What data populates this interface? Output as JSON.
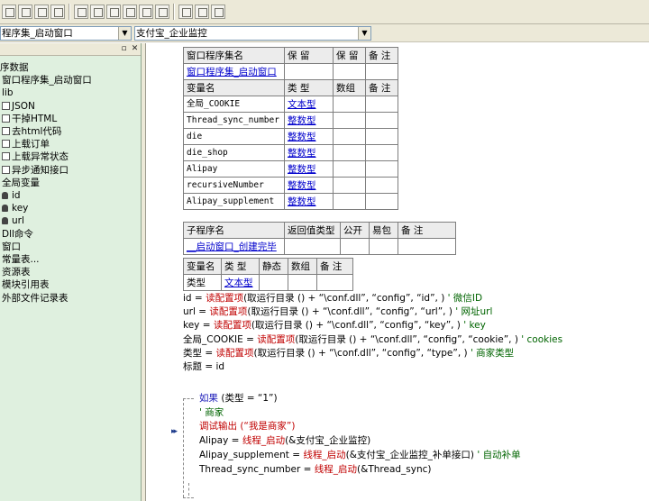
{
  "toolbar": {
    "icons": [
      "indent-icon",
      "outdent-icon",
      "compile-icon",
      "align-left-icon",
      "align-right-icon",
      "align-center-icon",
      "align-top-icon",
      "align-bottom-icon",
      "same-width-icon",
      "same-height-icon",
      "grid-icon"
    ]
  },
  "combos": {
    "left_value": "程序集_启动窗口",
    "right_value": "支付宝_企业监控"
  },
  "tree": {
    "items": [
      {
        "label": "序数据",
        "icon": "none"
      },
      {
        "label": "窗口程序集_启动窗口",
        "icon": "none"
      },
      {
        "label": "lib",
        "icon": "none"
      },
      {
        "label": "JSON",
        "icon": "class-module-icon"
      },
      {
        "label": "干掉HTML",
        "icon": "class-module-icon"
      },
      {
        "label": "去html代码",
        "icon": "class-module-icon"
      },
      {
        "label": "上载订单",
        "icon": "class-module-icon"
      },
      {
        "label": "上载异常状态",
        "icon": "class-module-icon"
      },
      {
        "label": "异步通知接口",
        "icon": "class-module-icon"
      },
      {
        "label": "全局变量",
        "icon": "none"
      },
      {
        "label": "id",
        "icon": "variable-icon"
      },
      {
        "label": "key",
        "icon": "variable-icon"
      },
      {
        "label": "url",
        "icon": "variable-icon"
      },
      {
        "label": "Dll命令",
        "icon": "none"
      },
      {
        "label": "窗口",
        "icon": "none"
      },
      {
        "label": "常量表...",
        "icon": "none"
      },
      {
        "label": "资源表",
        "icon": "none"
      },
      {
        "label": "模块引用表",
        "icon": "none"
      },
      {
        "label": "外部文件记录表",
        "icon": "none"
      }
    ]
  },
  "assembly_table": {
    "headers": [
      "窗口程序集名",
      "保 留",
      "保 留",
      "备 注"
    ],
    "name": "窗口程序集_启动窗口",
    "var_headers": [
      "变量名",
      "类 型",
      "数组",
      "备 注"
    ],
    "vars": [
      {
        "name": "全局_COOKIE",
        "type": "文本型"
      },
      {
        "name": "Thread_sync_number",
        "type": "整数型"
      },
      {
        "name": "die",
        "type": "整数型"
      },
      {
        "name": "die_shop",
        "type": "整数型"
      },
      {
        "name": "Alipay",
        "type": "整数型"
      },
      {
        "name": "recursiveNumber",
        "type": "整数型"
      },
      {
        "name": "Alipay_supplement",
        "type": "整数型"
      }
    ]
  },
  "sub_table": {
    "headers": [
      "子程序名",
      "返回值类型",
      "公开",
      "易包",
      "备 注"
    ],
    "name": "__启动窗口_创建完毕"
  },
  "local_table": {
    "headers": [
      "变量名",
      "类 型",
      "静态",
      "数组",
      "备 注"
    ],
    "name": "类型",
    "type": "文本型"
  },
  "code": {
    "assign_lines": [
      {
        "var": "id",
        "fn": "读配置项",
        "args": "(取运行目录 () + “\\conf.dll”, “config”, “id”, )",
        "comment": "' 微信ID"
      },
      {
        "var": "url",
        "fn": "读配置项",
        "args": "(取运行目录 () + “\\conf.dll”, “config”, “url”, )",
        "comment": "' 网址url"
      },
      {
        "var": "key",
        "fn": "读配置项",
        "args": "(取运行目录 () + “\\conf.dll”, “config”, “key”, )",
        "comment": "' key"
      },
      {
        "var": "全局_COOKIE",
        "fn": "读配置项",
        "args": "(取运行目录 () + “\\conf.dll”, “config”, “cookie”, )",
        "comment": "' cookies"
      },
      {
        "var": "类型",
        "fn": "读配置项",
        "args": "(取运行目录 () + “\\conf.dll”, “config”, “type”, )",
        "comment": "' 商家类型"
      },
      {
        "var": "标题",
        "fn": "",
        "args": "id",
        "comment": ""
      }
    ],
    "if_keyword": "如果",
    "if_cond": "(类型 = “1”)",
    "if_comment": "' 商家",
    "debug_line": "调试输出 (“我是商家”)",
    "thread_lines": [
      {
        "var": "Alipay",
        "fn": "线程_启动",
        "args": "(&支付宝_企业监控)",
        "comment": ""
      },
      {
        "var": "Alipay_supplement",
        "fn": "线程_启动",
        "args": "(&支付宝_企业监控_补单接口)",
        "comment": "' 自动补单"
      },
      {
        "var": "Thread_sync_number",
        "fn": "线程_启动",
        "args": "(&Thread_sync)",
        "comment": ""
      }
    ],
    "current_line_marker": "▸▸"
  }
}
